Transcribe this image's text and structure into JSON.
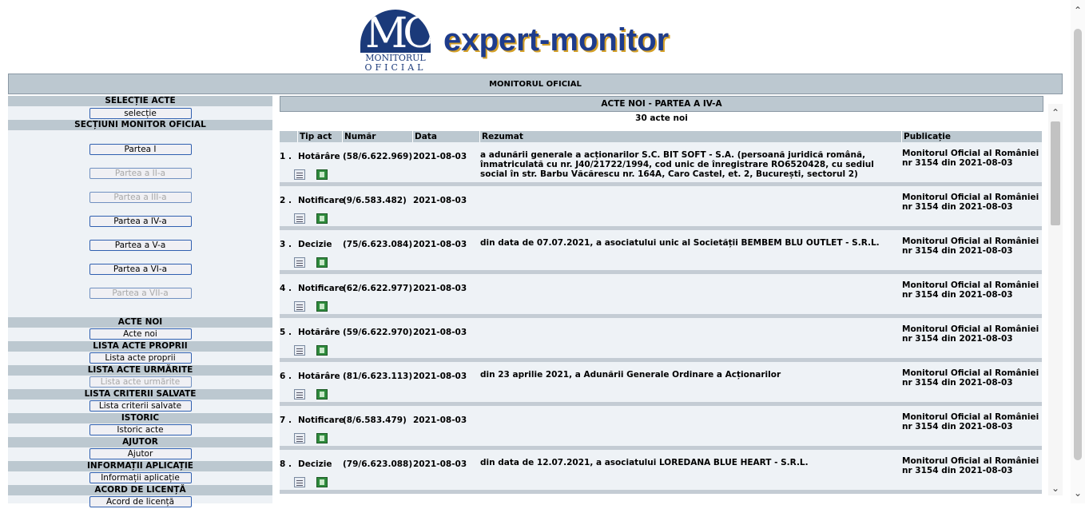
{
  "brand": {
    "logo_letters": "MO",
    "logo_line1": "MONITORUL",
    "logo_line2": "OFICIAL",
    "name": "expert-monitor"
  },
  "topbar": {
    "title": "MONITORUL OFICIAL"
  },
  "sidebar": {
    "selectie_header": "SELECȚIE ACTE",
    "selectie_btn": "selecție",
    "sectiuni_header": "SECȚIUNI MONITOR OFICIAL",
    "parts": [
      {
        "label": "Partea I",
        "enabled": true
      },
      {
        "label": "Partea a II-a",
        "enabled": false
      },
      {
        "label": "Partea a III-a",
        "enabled": false
      },
      {
        "label": "Partea a IV-a",
        "enabled": true
      },
      {
        "label": "Partea a V-a",
        "enabled": true
      },
      {
        "label": "Partea a VI-a",
        "enabled": true
      },
      {
        "label": "Partea a VII-a",
        "enabled": false
      }
    ],
    "acte_noi_header": "ACTE NOI",
    "acte_noi_btn": "Acte noi",
    "proprii_header": "LISTA ACTE PROPRII",
    "proprii_btn": "Lista acte proprii",
    "urmarite_header": "LISTA ACTE URMĂRITE",
    "urmarite_btn": "Lista acte urmărite",
    "criterii_header": "LISTA CRITERII SALVATE",
    "criterii_btn": "Lista criterii salvate",
    "istoric_header": "ISTORIC",
    "istoric_btn": "Istoric acte",
    "ajutor_header": "AJUTOR",
    "ajutor_btn": "Ajutor",
    "info_header": "INFORMAȚII APLICAȚIE",
    "info_btn": "Informații aplicație",
    "licenta_header": "ACORD DE LICENȚĂ",
    "licenta_btn": "Acord de licență"
  },
  "main": {
    "header": "ACTE NOI - PARTEA A IV-A",
    "count": "30 acte noi",
    "columns": {
      "tip": "Tip act",
      "numar": "Număr",
      "data": "Data",
      "rezumat": "Rezumat",
      "publicatie": "Publicație"
    },
    "rows": [
      {
        "idx": "1 .",
        "tip": "Hotărâre",
        "numar": "(58/6.622.969)",
        "data": "2021-08-03",
        "rezumat": "a adunării generale a acționarilor S.C. BIT SOFT - S.A. (persoană juridică română, înmatriculată cu nr. J40/21722/1994, cod unic de înregistrare RO6520428, cu sediul social în str. Barbu Văcărescu nr. 164A, Caro Castel, et. 2, București, sectorul 2)",
        "pub": "Monitorul Oficial al României nr 3154 din 2021-08-03"
      },
      {
        "idx": "2 .",
        "tip": "Notificare",
        "numar": "(9/6.583.482)",
        "data": "2021-08-03",
        "rezumat": "",
        "pub": "Monitorul Oficial al României nr 3154 din 2021-08-03"
      },
      {
        "idx": "3 .",
        "tip": "Decizie",
        "numar": "(75/6.623.084)",
        "data": "2021-08-03",
        "rezumat": "din data de 07.07.2021, a asociatului unic al Societății BEMBEM BLU OUTLET - S.R.L.",
        "pub": "Monitorul Oficial al României nr 3154 din 2021-08-03"
      },
      {
        "idx": "4 .",
        "tip": "Notificare",
        "numar": "(62/6.622.977)",
        "data": "2021-08-03",
        "rezumat": "",
        "pub": "Monitorul Oficial al României nr 3154 din 2021-08-03"
      },
      {
        "idx": "5 .",
        "tip": "Hotărâre",
        "numar": "(59/6.622.970)",
        "data": "2021-08-03",
        "rezumat": "",
        "pub": "Monitorul Oficial al României nr 3154 din 2021-08-03"
      },
      {
        "idx": "6 .",
        "tip": "Hotărâre",
        "numar": "(81/6.623.113)",
        "data": "2021-08-03",
        "rezumat": "din 23 aprilie 2021, a Adunării Generale Ordinare a Acționarilor",
        "pub": "Monitorul Oficial al României nr 3154 din 2021-08-03"
      },
      {
        "idx": "7 .",
        "tip": "Notificare",
        "numar": "(8/6.583.479)",
        "data": "2021-08-03",
        "rezumat": "",
        "pub": "Monitorul Oficial al României nr 3154 din 2021-08-03"
      },
      {
        "idx": "8 .",
        "tip": "Decizie",
        "numar": "(79/6.623.088)",
        "data": "2021-08-03",
        "rezumat": "din data de 12.07.2021, a asociatului LOREDANA BLUE HEART - S.R.L.",
        "pub": "Monitorul Oficial al României nr 3154 din 2021-08-03"
      }
    ]
  },
  "icons": {
    "view": "document-view-icon",
    "export": "excel-export-icon",
    "up": "chevron-up-icon",
    "down": "chevron-down-icon"
  }
}
